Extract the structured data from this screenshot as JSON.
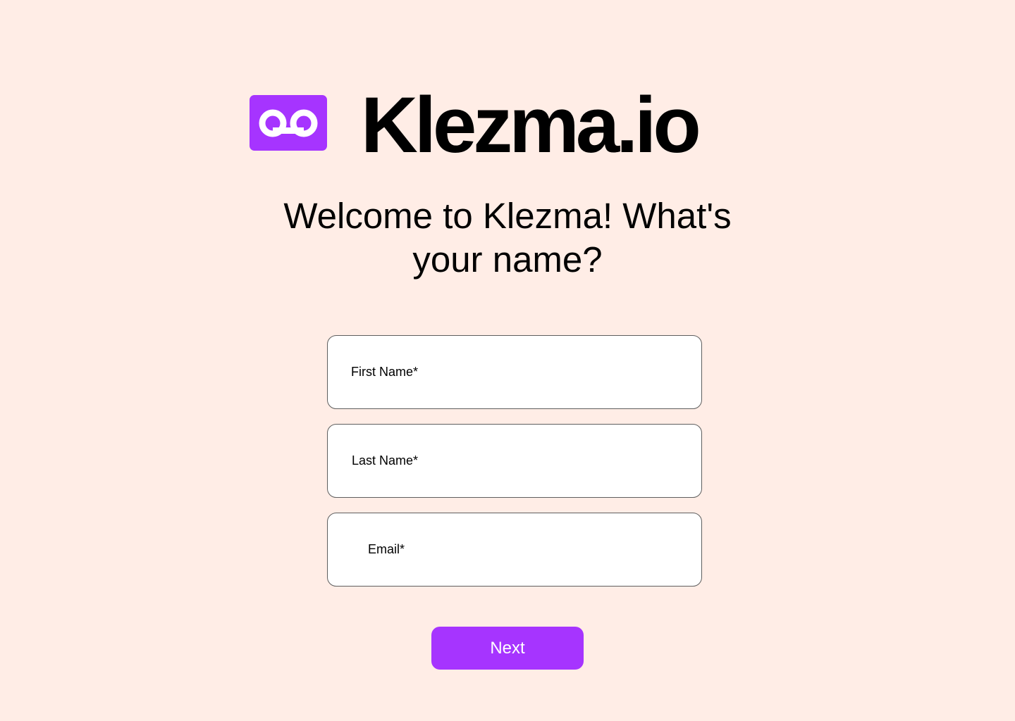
{
  "brand": {
    "name": "Klezma.io",
    "icon": "voicemail-icon",
    "accent_color": "#A634FF"
  },
  "page": {
    "background_color": "#FFEDE6",
    "headline": "Welcome to Klezma! What's your name?"
  },
  "form": {
    "first_name": {
      "placeholder": "First Name*",
      "value": ""
    },
    "last_name": {
      "placeholder": "Last Name*",
      "value": ""
    },
    "email": {
      "placeholder": "Email*",
      "value": ""
    },
    "next_label": "Next"
  }
}
